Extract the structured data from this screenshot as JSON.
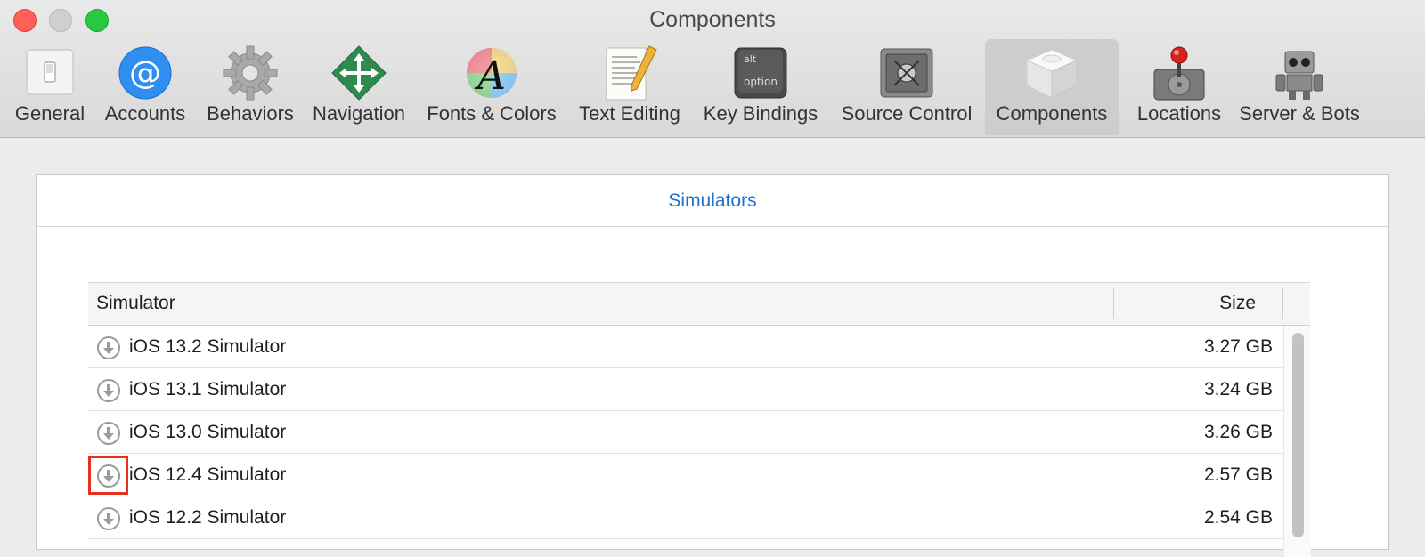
{
  "window": {
    "title": "Components"
  },
  "toolbar": {
    "items": [
      {
        "label": "General"
      },
      {
        "label": "Accounts"
      },
      {
        "label": "Behaviors"
      },
      {
        "label": "Navigation"
      },
      {
        "label": "Fonts & Colors"
      },
      {
        "label": "Text Editing"
      },
      {
        "label": "Key Bindings",
        "key_top": "alt",
        "key_bottom": "option"
      },
      {
        "label": "Source Control"
      },
      {
        "label": "Components"
      },
      {
        "label": "Locations"
      },
      {
        "label": "Server & Bots"
      }
    ],
    "active": "Components"
  },
  "panel": {
    "tab_title": "Simulators",
    "columns": {
      "name": "Simulator",
      "size": "Size"
    },
    "rows": [
      {
        "name": "iOS 13.2 Simulator",
        "size": "3.27 GB"
      },
      {
        "name": "iOS 13.1 Simulator",
        "size": "3.24 GB"
      },
      {
        "name": "iOS 13.0 Simulator",
        "size": "3.26 GB"
      },
      {
        "name": "iOS 12.4 Simulator",
        "size": "2.57 GB"
      },
      {
        "name": "iOS 12.2 Simulator",
        "size": "2.54 GB"
      }
    ]
  },
  "colors": {
    "accent": "#1f6fd1",
    "highlight": "#e8301f"
  }
}
